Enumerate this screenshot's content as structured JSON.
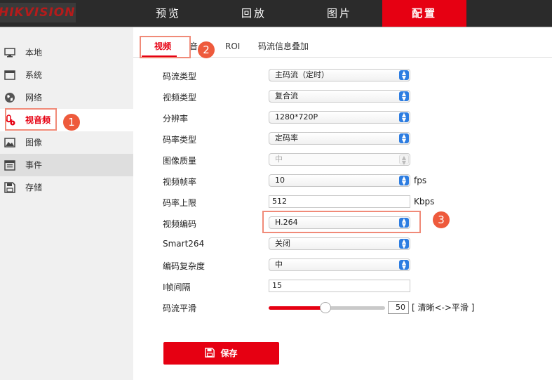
{
  "brand": {
    "logo_text": "HIKVISION"
  },
  "topnav": [
    {
      "label": "预览"
    },
    {
      "label": "回放"
    },
    {
      "label": "图片"
    },
    {
      "label": "配置"
    }
  ],
  "sidebar": {
    "items": [
      {
        "label": "本地",
        "icon": "monitor-icon"
      },
      {
        "label": "系统",
        "icon": "window-icon"
      },
      {
        "label": "网络",
        "icon": "globe-icon"
      },
      {
        "label": "视音频",
        "icon": "audio-video-icon"
      },
      {
        "label": "图像",
        "icon": "image-icon"
      },
      {
        "label": "事件",
        "icon": "calendar-icon"
      },
      {
        "label": "存储",
        "icon": "save-icon"
      }
    ]
  },
  "tabs": [
    {
      "label": "视频"
    },
    {
      "label": "音"
    },
    {
      "label": "ROI"
    },
    {
      "label": "码流信息叠加"
    }
  ],
  "callouts": [
    "1",
    "2",
    "3"
  ],
  "form": {
    "stream_type": {
      "label": "码流类型",
      "value": "主码流（定时）"
    },
    "video_type": {
      "label": "视频类型",
      "value": "复合流"
    },
    "resolution": {
      "label": "分辨率",
      "value": "1280*720P"
    },
    "bitrate_type": {
      "label": "码率类型",
      "value": "定码率"
    },
    "image_quality": {
      "label": "图像质量",
      "value": "中"
    },
    "frame_rate": {
      "label": "视频帧率",
      "value": "10",
      "unit": "fps"
    },
    "max_bitrate": {
      "label": "码率上限",
      "value": "512",
      "unit": "Kbps"
    },
    "video_encoding": {
      "label": "视频编码",
      "value": "H.264"
    },
    "smart264": {
      "label": "Smart264",
      "value": "关闭"
    },
    "encoding_complexity": {
      "label": "编码复杂度",
      "value": "中"
    },
    "i_frame_interval": {
      "label": "I帧间隔",
      "value": "15"
    },
    "stream_smoothing": {
      "label": "码流平滑",
      "value": "50",
      "hint": "[ 清晰<->平滑 ]",
      "level": 50
    }
  },
  "save_label": "保存",
  "colors": {
    "accent": "#e60012",
    "callout": "#ee5a3c",
    "select_arrow": "#2d7de1"
  }
}
